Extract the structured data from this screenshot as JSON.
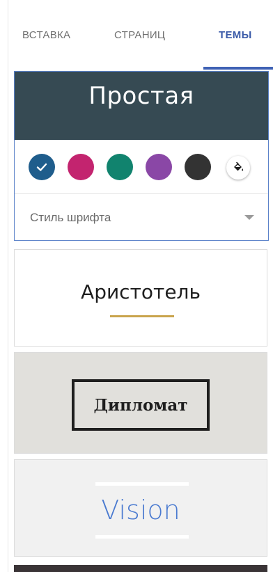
{
  "tabs": [
    {
      "label": "ВСТАВКА",
      "active": false
    },
    {
      "label": "СТРАНИЦ",
      "active": false
    },
    {
      "label": "ТЕМЫ",
      "active": true
    }
  ],
  "colors": {
    "accent": "#3f62b5",
    "selected_border": "#5b82c9",
    "simple_header_bg": "#364a53"
  },
  "selected_theme": {
    "title": "Простая",
    "swatches": [
      {
        "color": "#1f5d8c",
        "selected": true
      },
      {
        "color": "#c3246f",
        "selected": false
      },
      {
        "color": "#11836e",
        "selected": false
      },
      {
        "color": "#8a47a6",
        "selected": false
      },
      {
        "color": "#333333",
        "selected": false
      }
    ],
    "checkmark_icon": "check-icon",
    "paint_icon": "paint-bucket-icon",
    "font_style_label": "Стиль шрифта"
  },
  "themes": {
    "aristotle": {
      "name": "Аристотель",
      "accent": "#c9a44d"
    },
    "diplomat": {
      "name": "Дипломат",
      "bg": "#e1e0dc"
    },
    "vision": {
      "name": "Vision",
      "color": "#4a7ad0"
    }
  }
}
